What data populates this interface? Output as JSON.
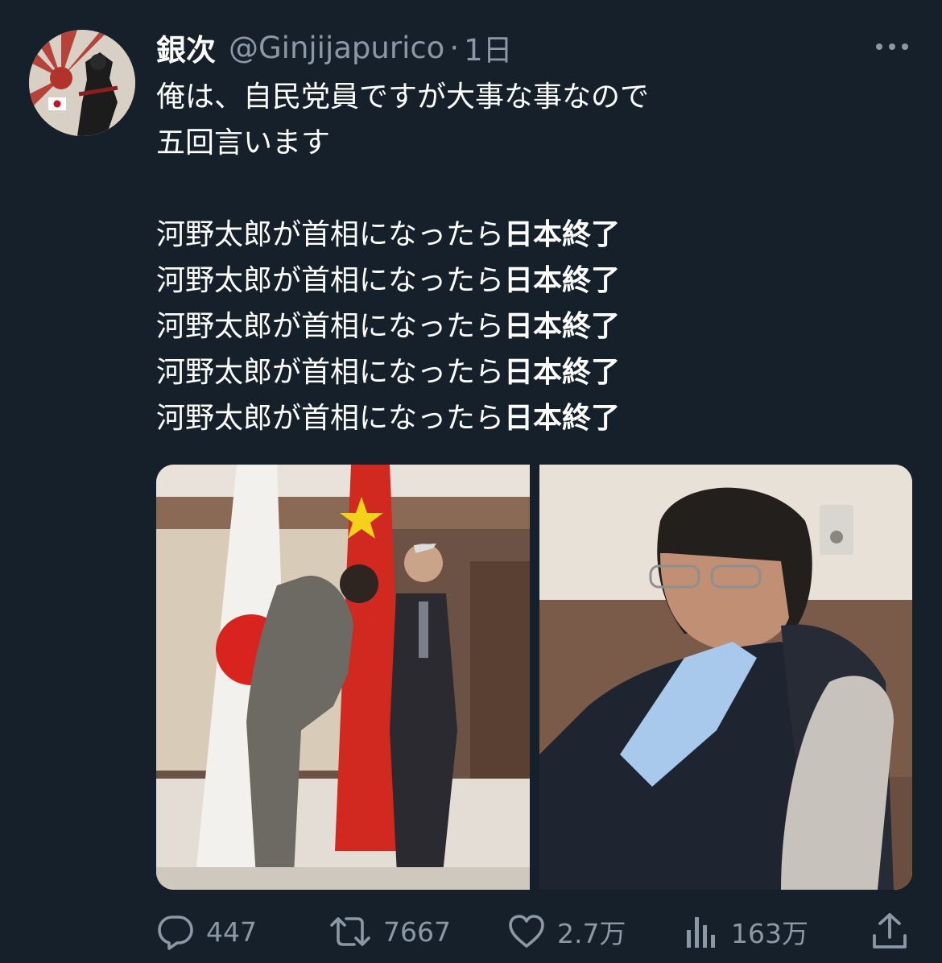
{
  "tweet": {
    "display_name": "銀次",
    "handle": "@Ginjijapurico",
    "separator": "·",
    "time": "1日",
    "text_lines": [
      "俺は、自民党員ですが大事な事なので",
      "五回言います"
    ],
    "repeat_lines": [
      {
        "normal": "河野太郎が首相になったら",
        "bold": "日本終了"
      },
      {
        "normal": "河野太郎が首相になったら",
        "bold": "日本終了"
      },
      {
        "normal": "河野太郎が首相になったら",
        "bold": "日本終了"
      },
      {
        "normal": "河野太郎が首相になったら",
        "bold": "日本終了"
      },
      {
        "normal": "河野太郎が首相になったら",
        "bold": "日本終了"
      }
    ]
  },
  "actions": {
    "reply_count": "447",
    "retweet_count": "7667",
    "like_count": "2.7万",
    "views_count": "163万"
  },
  "icons": {
    "more": "more-horizontal-icon",
    "reply": "reply-icon",
    "retweet": "retweet-icon",
    "like": "heart-icon",
    "views": "views-icon",
    "share": "share-icon"
  },
  "colors": {
    "background": "#16202b",
    "text": "#ffffff",
    "secondary_text": "#8b98a5"
  }
}
